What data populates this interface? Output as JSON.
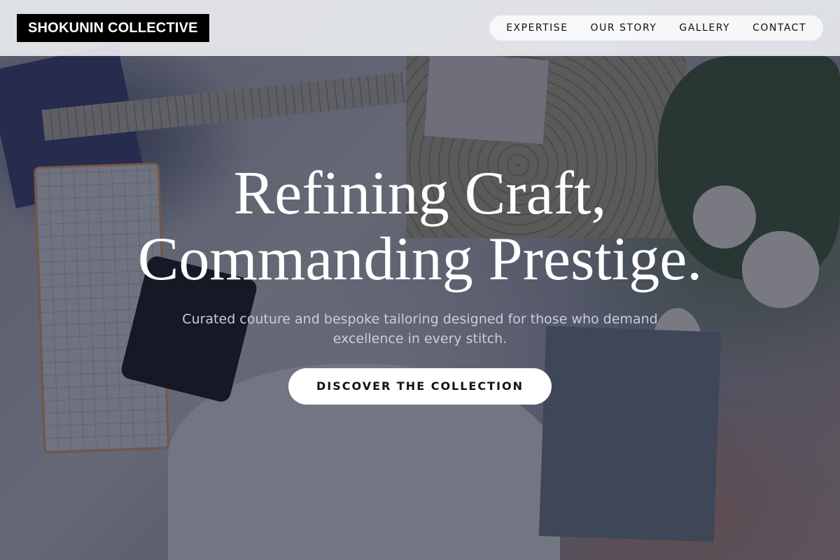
{
  "brand": {
    "name": "SHOKUNIN COLLECTIVE"
  },
  "nav": {
    "links": [
      "EXPERTISE",
      "OUR STORY",
      "GALLERY",
      "CONTACT"
    ]
  },
  "hero": {
    "headline_line1": "Refining Craft,",
    "headline_line2": "Commanding Prestige.",
    "subtitle": "Curated couture and bespoke tailoring designed for those who demand excellence in every stitch.",
    "cta_label": "DISCOVER THE COLLECTION"
  },
  "colors": {
    "brand_bg": "#000000",
    "nav_bg": "#eceef2",
    "overlay": "#181c2c",
    "cta_bg": "#ffffff"
  }
}
